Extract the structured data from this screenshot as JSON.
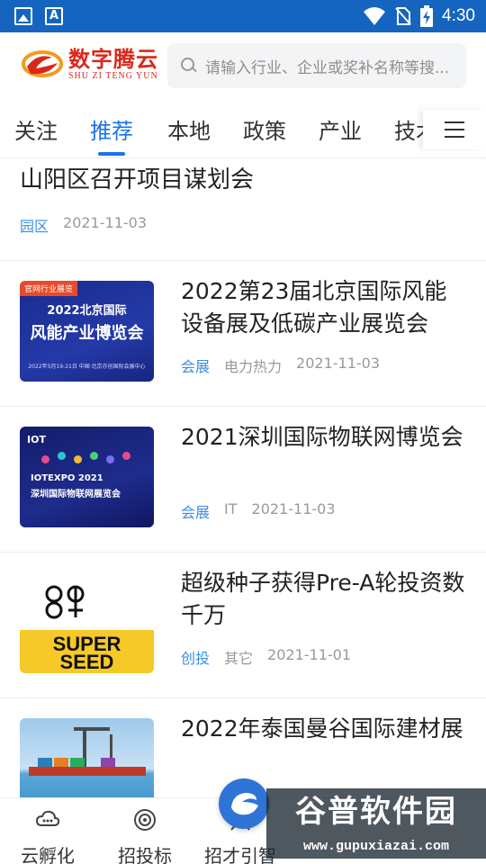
{
  "status_bar": {
    "time": "4:30",
    "icons": [
      "image-icon",
      "a-icon",
      "wifi-icon",
      "no-sim-icon",
      "battery-charging-icon"
    ]
  },
  "header": {
    "logo_cn": "数字腾云",
    "logo_en": "SHU ZI TENG YUN",
    "search_placeholder": "请输入行业、企业或奖补名称等搜..."
  },
  "tabs": {
    "items": [
      {
        "label": "关注",
        "active": false
      },
      {
        "label": "推荐",
        "active": true
      },
      {
        "label": "本地",
        "active": false
      },
      {
        "label": "政策",
        "active": false
      },
      {
        "label": "产业",
        "active": false
      },
      {
        "label": "技术",
        "active": false
      }
    ],
    "menu_icon": "hamburger-menu-icon"
  },
  "feed": {
    "top_item": {
      "title": "山阳区召开项目谋划会",
      "category": "园区",
      "date": "2021-11-03"
    },
    "items": [
      {
        "title": "2022第23届北京国际风能设备展及低碳产业展览会",
        "category": "会展",
        "tag": "电力热力",
        "date": "2021-11-03",
        "thumb": {
          "badge": "官网行业展览",
          "line1": "2022北京国际",
          "line2": "风能产业博览会",
          "line3": "2022年5月19-21日 中国·北京亦创国际会展中心"
        }
      },
      {
        "title": "2021深圳国际物联网博览会",
        "category": "会展",
        "tag": "IT",
        "date": "2021-11-03",
        "thumb": {
          "logo": "IOT",
          "line1": "IOTEXPO 2021",
          "line2": "深圳国际物联网展览会"
        }
      },
      {
        "title": "超级种子获得Pre-A轮投资数千万",
        "category": "创投",
        "tag": "其它",
        "date": "2021-11-01",
        "thumb": {
          "line1": "SUPER",
          "line2": "SEED"
        }
      },
      {
        "title": "2022年泰国曼谷国际建材展",
        "category": "",
        "tag": "",
        "date": "",
        "thumb": {}
      }
    ]
  },
  "tabbar": {
    "items": [
      {
        "label": "云孵化",
        "icon": "cloud-icon"
      },
      {
        "label": "招投标",
        "icon": "target-icon"
      },
      {
        "label": "招才引智",
        "icon": "talent-icon"
      }
    ],
    "center_icon": "app-logo-icon"
  },
  "watermark": {
    "text": "谷普软件园",
    "url": "www.gupuxiazai.com"
  },
  "colors": {
    "status_bar": "#1565c0",
    "accent": "#1a73e8",
    "category": "#3a8ee6",
    "logo": "#d9281a"
  }
}
